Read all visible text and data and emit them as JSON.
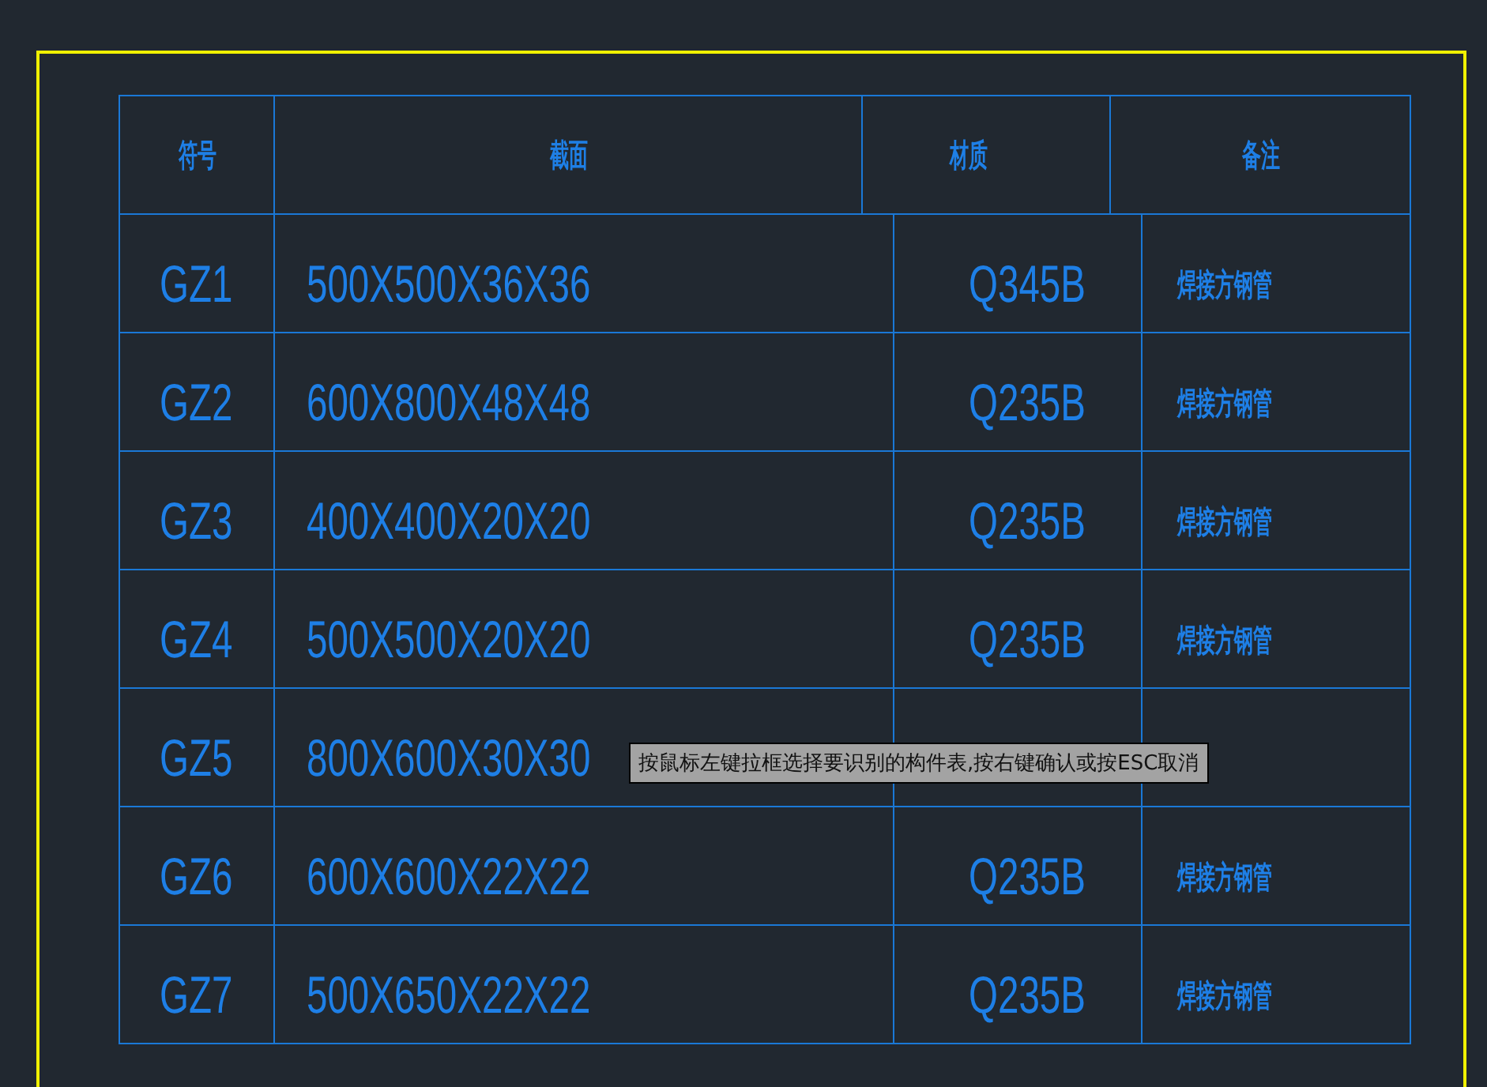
{
  "table": {
    "columns": [
      "符号",
      "截面",
      "材质",
      "备注"
    ],
    "rows": [
      {
        "symbol": "GZ1",
        "section": "500X500X36X36",
        "material": "Q345B",
        "note": "焊接方钢管"
      },
      {
        "symbol": "GZ2",
        "section": "600X800X48X48",
        "material": "Q235B",
        "note": "焊接方钢管"
      },
      {
        "symbol": "GZ3",
        "section": "400X400X20X20",
        "material": "Q235B",
        "note": "焊接方钢管"
      },
      {
        "symbol": "GZ4",
        "section": "500X500X20X20",
        "material": "Q235B",
        "note": "焊接方钢管"
      },
      {
        "symbol": "GZ5",
        "section": "800X600X30X30"
      },
      {
        "symbol": "GZ6",
        "section": "600X600X22X22",
        "material": "Q235B",
        "note": "焊接方钢管"
      },
      {
        "symbol": "GZ7",
        "section": "500X650X22X22",
        "material": "Q235B",
        "note": "焊接方钢管"
      }
    ]
  },
  "tooltip": "按鼠标左键拉框选择要识别的构件表,按右键确认或按ESC取消"
}
